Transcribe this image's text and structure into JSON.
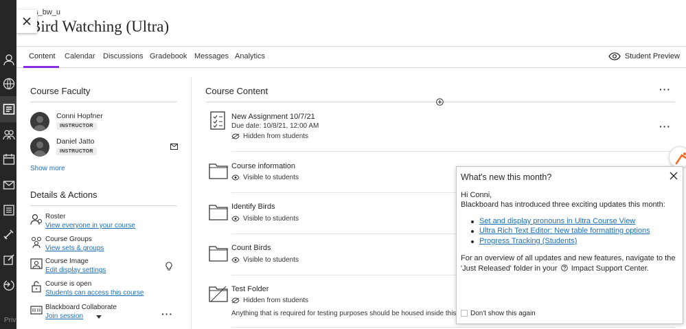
{
  "course": {
    "code": "es_bw_u",
    "title": "Bird Watching (Ultra)"
  },
  "tabs": [
    {
      "label": "Content"
    },
    {
      "label": "Calendar"
    },
    {
      "label": "Discussions"
    },
    {
      "label": "Gradebook"
    },
    {
      "label": "Messages"
    },
    {
      "label": "Analytics"
    }
  ],
  "student_preview": "Student Preview",
  "faculty": {
    "title": "Course Faculty",
    "members": [
      {
        "name": "Conni Hopfner",
        "role": "INSTRUCTOR"
      },
      {
        "name": "Daniel Jatto",
        "role": "INSTRUCTOR"
      }
    ],
    "show_more": "Show more"
  },
  "details": {
    "title": "Details & Actions",
    "items": [
      {
        "title": "Roster",
        "link": "View everyone in your course",
        "icon": "roster-icon"
      },
      {
        "title": "Course Groups",
        "link": "View sets & groups",
        "icon": "groups-icon"
      },
      {
        "title": "Course Image",
        "link": "Edit display settings",
        "icon": "image-icon"
      },
      {
        "title": "Course is open",
        "link": "Students can access this course",
        "icon": "unlock-icon"
      },
      {
        "title": "Blackboard Collaborate",
        "link": "Join session",
        "icon": "collaborate-icon"
      }
    ]
  },
  "content": {
    "title": "Course Content",
    "items": [
      {
        "name": "New Assignment 10/7/21",
        "due": "Due date: 10/8/21, 12:00 AM",
        "visibility": "Hidden from students",
        "type": "assignment"
      },
      {
        "name": "Course information",
        "visibility": "Visible to students",
        "type": "folder"
      },
      {
        "name": "Identify Birds",
        "visibility": "Visible to students",
        "type": "folder"
      },
      {
        "name": "Count Birds",
        "visibility": "Visible to students",
        "type": "folder"
      },
      {
        "name": "Test Folder",
        "visibility": "Hidden from students",
        "description": "Anything that is required for testing purposes should be housed inside this f",
        "type": "folder-hidden"
      }
    ]
  },
  "popup": {
    "title": "What's new this month?",
    "greeting": "Hi Conni,",
    "intro": "Blackboard has introduced three exciting updates this month:",
    "links": [
      "Set and display pronouns in Ultra Course View",
      "Ultra Rich Text Editor: New table formatting options",
      "Progress Tracking (Students)"
    ],
    "overview_line1": "For an overview of all updates and new features, navigate to the",
    "overview_line2": "'Just Released' folder in your",
    "overview_line2_end": "Impact Support Center.",
    "dont_show": "Don't show this again"
  },
  "rail_footer": "Priv",
  "colors": {
    "accent": "#8a2be2",
    "link": "#1b6eb6",
    "rail": "#262626"
  }
}
